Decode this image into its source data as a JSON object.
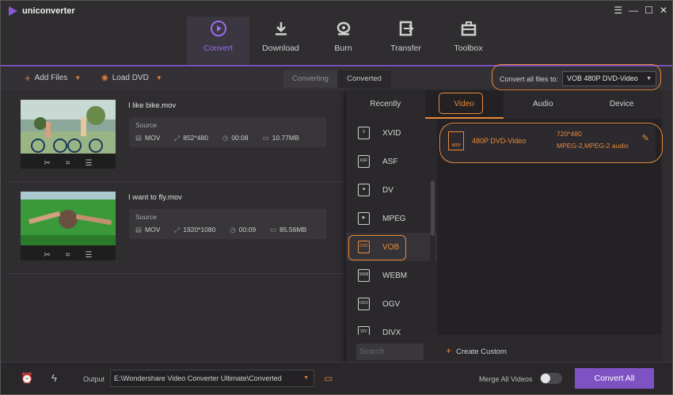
{
  "app": {
    "name": "uniconverter"
  },
  "window_controls": [
    "☰",
    "—",
    "☐",
    "✕"
  ],
  "nav": [
    {
      "label": "Convert",
      "icon": "convert-icon",
      "active": true
    },
    {
      "label": "Download",
      "icon": "download-icon"
    },
    {
      "label": "Burn",
      "icon": "burn-icon"
    },
    {
      "label": "Transfer",
      "icon": "transfer-icon"
    },
    {
      "label": "Toolbox",
      "icon": "toolbox-icon"
    }
  ],
  "toolbar": {
    "add_files": "Add Files",
    "load_dvd": "Load DVD",
    "seg_converting": "Converting",
    "seg_converted": "Converted",
    "convert_all_label": "Convert all files to:",
    "convert_all_value": "VOB 480P DVD-Video"
  },
  "files": [
    {
      "name": "I like bike.mov",
      "source_label": "Source",
      "format": "MOV",
      "resolution": "852*480",
      "duration": "00:08",
      "size": "10.77MB"
    },
    {
      "name": "I want to fly.mov",
      "source_label": "Source",
      "format": "MOV",
      "resolution": "1920*1080",
      "duration": "00:09",
      "size": "85.56MB"
    }
  ],
  "panel": {
    "tabs": [
      "Recently",
      "Video",
      "Audio",
      "Device"
    ],
    "active_tab": "Video",
    "formats": [
      {
        "label": "XVID",
        "icon": "xvid-icon"
      },
      {
        "label": "ASF",
        "icon": "asf-icon"
      },
      {
        "label": "DV",
        "icon": "dv-icon"
      },
      {
        "label": "MPEG",
        "icon": "mpeg-icon"
      },
      {
        "label": "VOB",
        "icon": "vob-icon",
        "active": true
      },
      {
        "label": "WEBM",
        "icon": "webm-icon"
      },
      {
        "label": "OGV",
        "icon": "ogv-icon"
      },
      {
        "label": "DIVX",
        "icon": "divx-icon"
      }
    ],
    "preset": {
      "name": "480P DVD-Video",
      "resolution": "720*480",
      "codec": "MPEG-2,MPEG-2 audio",
      "icon_text": "480P"
    },
    "search_placeholder": "Search",
    "create_custom": "Create Custom"
  },
  "bottom": {
    "output_label": "Output",
    "output_path": "E:\\Wondershare Video Converter Ultimate\\Converted",
    "merge_label": "Merge All Videos",
    "convert_all": "Convert All"
  },
  "colors": {
    "accent": "#e8893a",
    "brand": "#7e52c2"
  }
}
